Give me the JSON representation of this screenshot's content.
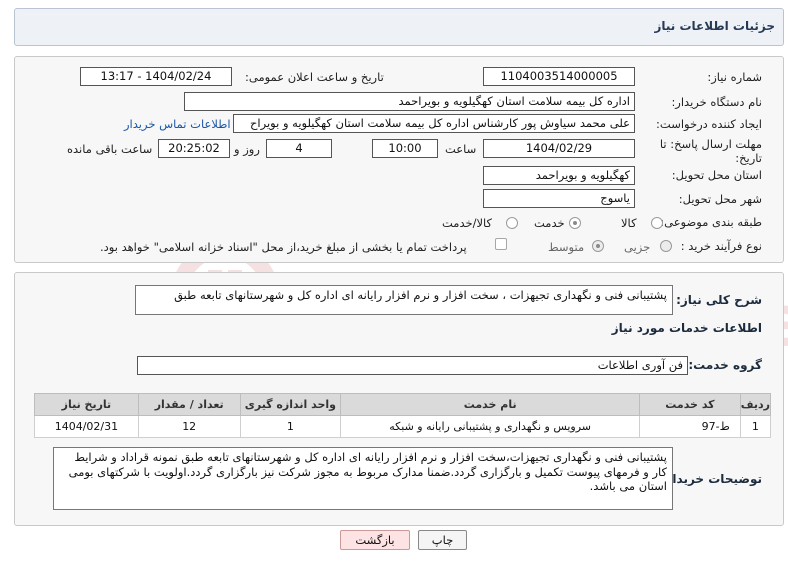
{
  "header": {
    "title": "جزئیات اطلاعات نیاز"
  },
  "form": {
    "need_number_label": "شماره نیاز:",
    "need_number": "1104003514000005",
    "announce_label": "تاریخ و ساعت اعلان عمومی:",
    "announce_value": "1404/02/24 - 13:17",
    "buyer_org_label": "نام دستگاه خریدار:",
    "buyer_org": "اداره کل بیمه سلامت استان کهگیلویه و بویراحمد",
    "creator_label": "ایجاد کننده درخواست:",
    "creator": "علی محمد سیاوش پور کارشناس اداره کل بیمه سلامت استان کهگیلویه و بویراح",
    "contact_link": "اطلاعات تماس خریدار",
    "deadline_label": "مهلت ارسال پاسخ: تا تاریخ:",
    "deadline_date": "1404/02/29",
    "time_label": "ساعت",
    "deadline_time": "10:00",
    "days_value": "4",
    "days_label": "روز و",
    "remaining_time": "20:25:02",
    "remaining_label": "ساعت باقی مانده",
    "province_label": "استان محل تحویل:",
    "province": "کهگیلویه و بویراحمد",
    "city_label": "شهر محل تحویل:",
    "city": "یاسوج",
    "category_label": "طبقه بندی موضوعی:",
    "category_options": [
      "کالا",
      "خدمت",
      "کالا/خدمت"
    ],
    "category_selected": "خدمت",
    "process_label": "نوع فرآیند خرید :",
    "process_options": [
      "جزیی",
      "متوسط"
    ],
    "process_selected": "متوسط",
    "payment_note": "پرداخت تمام یا بخشی از مبلغ خرید،از محل \"اسناد خزانه اسلامی\" خواهد بود."
  },
  "summary": {
    "label": "شرح کلی نیاز:",
    "text": "پشتیبانی فنی و نگهداری تجیهزات ، سخت افزار و نرم افزار رایانه ای اداره کل و شهرستانهای تابعه طبق"
  },
  "services": {
    "section_title": "اطلاعات خدمات مورد نیاز",
    "group_label": "گروه خدمت:",
    "group_value": "فن آوری اطلاعات",
    "columns": [
      "ردیف",
      "کد خدمت",
      "نام خدمت",
      "واحد اندازه گیری",
      "تعداد / مقدار",
      "تاریخ نیاز"
    ],
    "rows": [
      [
        "1",
        "ط-97",
        "سرویس و نگهداری و پشتیبانی رایانه و شبکه",
        "1",
        "12",
        "1404/02/31"
      ]
    ]
  },
  "buyer_notes": {
    "label": "توضیحات خریدار:",
    "text": "پشتیبانی فنی و نگهداری تجیهزات،سخت افزار و نرم افزار رایانه ای اداره کل و شهرستانهای تابعه طبق نمونه قراداد و شرایط کار و فرمهای پیوست تکمیل و بارگزاری گردد.ضمنا مدارک مربوط به مجوز شرکت نیز بارگزاری گردد.اولویت با شرکتهای بومی استان می باشد."
  },
  "buttons": {
    "print": "چاپ",
    "back": "بازگشت"
  },
  "watermark": {
    "text": "AriaTender.neT",
    "color": "#b52020"
  }
}
